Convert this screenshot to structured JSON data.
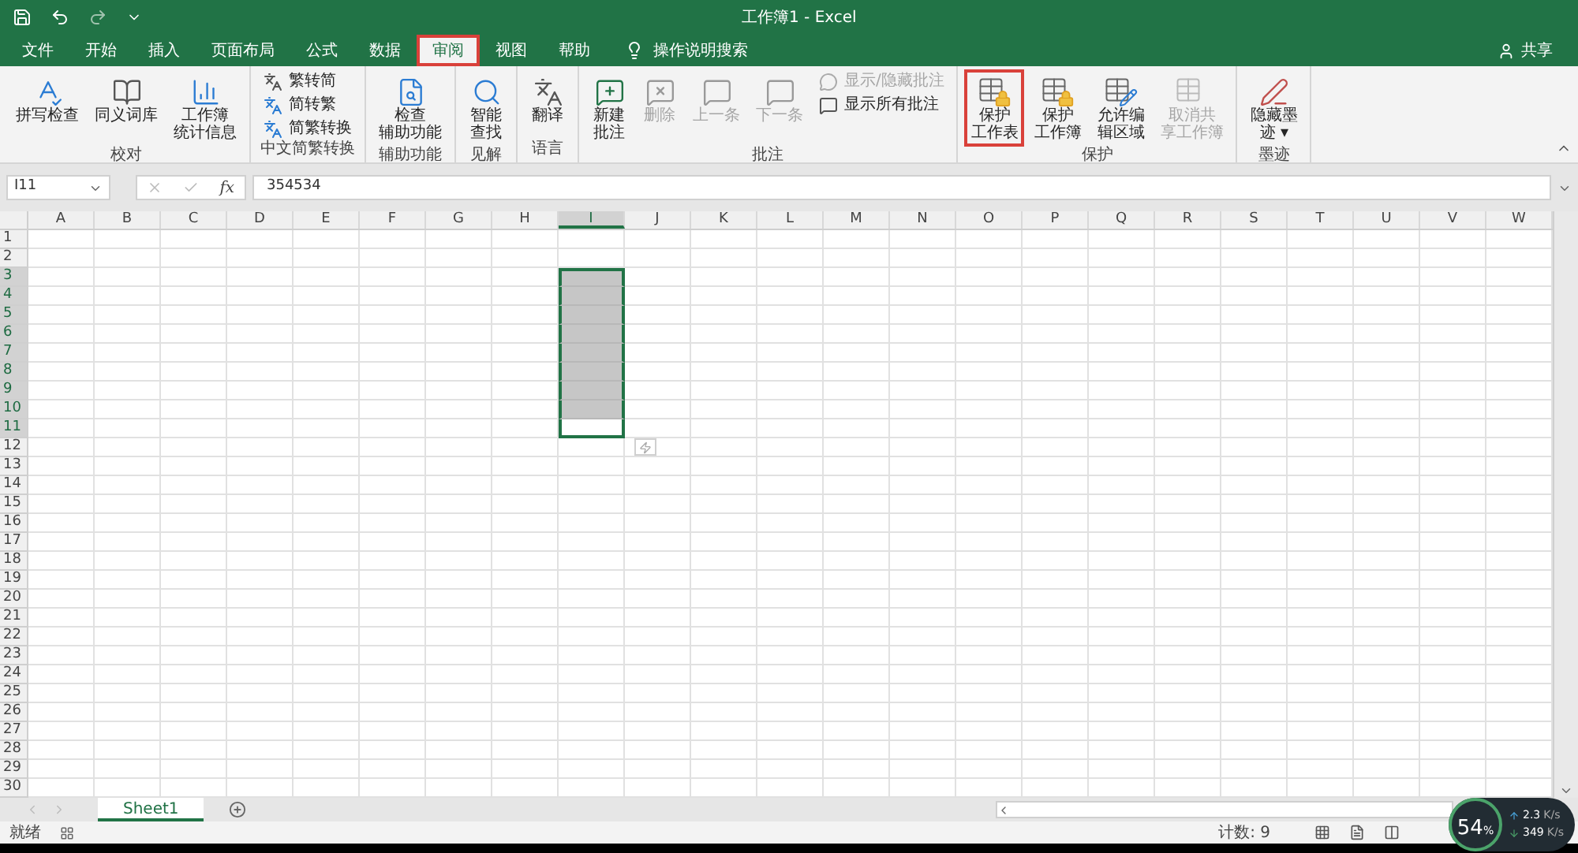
{
  "window": {
    "title": "工作簿1 - Excel"
  },
  "tabs": [
    {
      "label": "文件",
      "selected": false,
      "highlighted": false
    },
    {
      "label": "开始",
      "selected": false,
      "highlighted": false
    },
    {
      "label": "插入",
      "selected": false,
      "highlighted": false
    },
    {
      "label": "页面布局",
      "selected": false,
      "highlighted": false
    },
    {
      "label": "公式",
      "selected": false,
      "highlighted": false
    },
    {
      "label": "数据",
      "selected": false,
      "highlighted": false
    },
    {
      "label": "审阅",
      "selected": true,
      "highlighted": true
    },
    {
      "label": "视图",
      "selected": false,
      "highlighted": false
    },
    {
      "label": "帮助",
      "selected": false,
      "highlighted": false
    }
  ],
  "tell_me": {
    "label": "操作说明搜索"
  },
  "share": {
    "label": "共享"
  },
  "ribbon": [
    {
      "label": "校对",
      "items": [
        {
          "kind": "large",
          "lines": [
            "拼写检查"
          ],
          "disabled": false,
          "highlighted": false
        },
        {
          "kind": "large",
          "lines": [
            "同义词库"
          ],
          "disabled": false,
          "highlighted": false
        },
        {
          "kind": "large",
          "lines": [
            "工作簿",
            "统计信息"
          ],
          "disabled": false,
          "highlighted": false
        }
      ]
    },
    {
      "label": "中文简繁转换",
      "items": [
        {
          "kind": "small",
          "lines": [
            "繁转简"
          ],
          "disabled": false,
          "highlighted": false
        },
        {
          "kind": "small",
          "lines": [
            "简转繁"
          ],
          "disabled": false,
          "highlighted": false
        },
        {
          "kind": "small",
          "lines": [
            "简繁转换"
          ],
          "disabled": false,
          "highlighted": false
        }
      ]
    },
    {
      "label": "辅助功能",
      "items": [
        {
          "kind": "large",
          "lines": [
            "检查",
            "辅助功能"
          ],
          "disabled": false,
          "highlighted": false
        }
      ]
    },
    {
      "label": "见解",
      "items": [
        {
          "kind": "large",
          "lines": [
            "智能",
            "查找"
          ],
          "disabled": false,
          "highlighted": false
        }
      ]
    },
    {
      "label": "语言",
      "items": [
        {
          "kind": "large",
          "lines": [
            "翻译"
          ],
          "disabled": false,
          "highlighted": false
        }
      ]
    },
    {
      "label": "批注",
      "items": [
        {
          "kind": "large",
          "lines": [
            "新建",
            "批注"
          ],
          "disabled": false,
          "highlighted": false
        },
        {
          "kind": "large",
          "lines": [
            "删除"
          ],
          "disabled": true,
          "highlighted": false
        },
        {
          "kind": "large",
          "lines": [
            "上一条"
          ],
          "disabled": true,
          "highlighted": false
        },
        {
          "kind": "large",
          "lines": [
            "下一条"
          ],
          "disabled": true,
          "highlighted": false
        },
        {
          "kind": "small",
          "lines": [
            "显示/隐藏批注"
          ],
          "disabled": true,
          "highlighted": false
        },
        {
          "kind": "small",
          "lines": [
            "显示所有批注"
          ],
          "disabled": false,
          "highlighted": false
        }
      ]
    },
    {
      "label": "保护",
      "items": [
        {
          "kind": "large",
          "lines": [
            "保护",
            "工作表"
          ],
          "disabled": false,
          "highlighted": true
        },
        {
          "kind": "large",
          "lines": [
            "保护",
            "工作簿"
          ],
          "disabled": false,
          "highlighted": false
        },
        {
          "kind": "large",
          "lines": [
            "允许编",
            "辑区域"
          ],
          "disabled": false,
          "highlighted": false
        },
        {
          "kind": "large",
          "lines": [
            "取消共",
            "享工作簿"
          ],
          "disabled": true,
          "highlighted": false
        }
      ]
    },
    {
      "label": "墨迹",
      "items": [
        {
          "kind": "large",
          "lines": [
            "隐藏墨",
            "迹 ▾"
          ],
          "disabled": false,
          "highlighted": false
        }
      ]
    }
  ],
  "name_box": {
    "value": "I11"
  },
  "formula_bar": {
    "function_label": "fx",
    "value": "354534"
  },
  "columns": [
    {
      "label": "A",
      "selected": false
    },
    {
      "label": "B",
      "selected": false
    },
    {
      "label": "C",
      "selected": false
    },
    {
      "label": "D",
      "selected": false
    },
    {
      "label": "E",
      "selected": false
    },
    {
      "label": "F",
      "selected": false
    },
    {
      "label": "G",
      "selected": false
    },
    {
      "label": "H",
      "selected": false
    },
    {
      "label": "I",
      "selected": true
    },
    {
      "label": "J",
      "selected": false
    },
    {
      "label": "K",
      "selected": false
    },
    {
      "label": "L",
      "selected": false
    },
    {
      "label": "M",
      "selected": false
    },
    {
      "label": "N",
      "selected": false
    },
    {
      "label": "O",
      "selected": false
    },
    {
      "label": "P",
      "selected": false
    },
    {
      "label": "Q",
      "selected": false
    },
    {
      "label": "R",
      "selected": false
    },
    {
      "label": "S",
      "selected": false
    },
    {
      "label": "T",
      "selected": false
    },
    {
      "label": "U",
      "selected": false
    },
    {
      "label": "V",
      "selected": false
    },
    {
      "label": "W",
      "selected": false
    }
  ],
  "rows": [
    {
      "label": "1",
      "selected": false
    },
    {
      "label": "2",
      "selected": false
    },
    {
      "label": "3",
      "selected": true
    },
    {
      "label": "4",
      "selected": true
    },
    {
      "label": "5",
      "selected": true
    },
    {
      "label": "6",
      "selected": true
    },
    {
      "label": "7",
      "selected": true
    },
    {
      "label": "8",
      "selected": true
    },
    {
      "label": "9",
      "selected": true
    },
    {
      "label": "10",
      "selected": true
    },
    {
      "label": "11",
      "selected": true,
      "active": true
    },
    {
      "label": "12",
      "selected": false
    },
    {
      "label": "13",
      "selected": false
    },
    {
      "label": "14",
      "selected": false
    },
    {
      "label": "15",
      "selected": false
    },
    {
      "label": "16",
      "selected": false
    },
    {
      "label": "17",
      "selected": false
    },
    {
      "label": "18",
      "selected": false
    },
    {
      "label": "19",
      "selected": false
    },
    {
      "label": "20",
      "selected": false
    },
    {
      "label": "21",
      "selected": false
    },
    {
      "label": "22",
      "selected": false
    },
    {
      "label": "23",
      "selected": false
    },
    {
      "label": "24",
      "selected": false
    },
    {
      "label": "25",
      "selected": false
    },
    {
      "label": "26",
      "selected": false
    },
    {
      "label": "27",
      "selected": false
    },
    {
      "label": "28",
      "selected": false
    },
    {
      "label": "29",
      "selected": false
    },
    {
      "label": "30",
      "selected": false
    }
  ],
  "sheets": [
    {
      "label": "Sheet1",
      "selected": true
    }
  ],
  "status_bar": {
    "mode": "就绪",
    "count": "计数: 9"
  },
  "speed_widget": {
    "percent": "54",
    "percent_sign": "%",
    "upload": "2.3",
    "upload_unit": "K/s",
    "download": "349",
    "download_unit": "K/s"
  }
}
